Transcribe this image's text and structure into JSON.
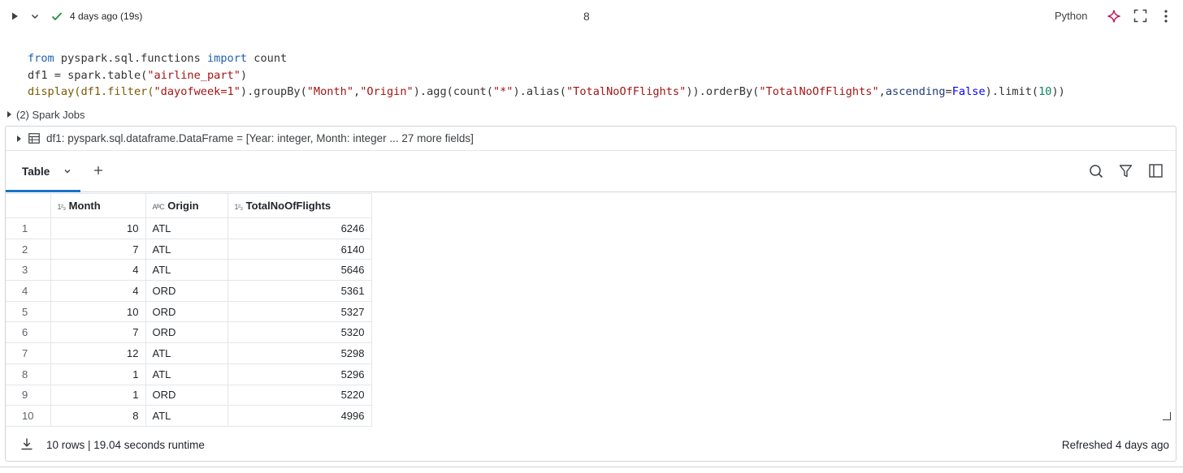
{
  "cell": {
    "status": "4 days ago (19s)",
    "number": "8",
    "language": "Python"
  },
  "code": {
    "line1": [
      "from",
      " pyspark.sql.functions ",
      "import",
      " count"
    ],
    "line2": [
      "df1 = spark.table(",
      "\"airline_part\"",
      ")"
    ],
    "line3": {
      "a": "display(df1.filter(",
      "b": "\"dayofweek=1\"",
      "c": ").groupBy(",
      "d": "\"Month\"",
      "e": ",",
      "f": "\"Origin\"",
      "g": ").agg(count(",
      "h": "\"*\"",
      "i": ").alias(",
      "j": "\"TotalNoOfFlights\"",
      "k": ")).orderBy(",
      "l": "\"TotalNoOfFlights\"",
      "m": ",",
      "n": "ascending",
      "o": "=",
      "p": "False",
      "q": ").limit(",
      "r": "10",
      "s": "))"
    }
  },
  "spark_jobs": "(2) Spark Jobs",
  "dataframe": {
    "summary": "df1:  pyspark.sql.dataframe.DataFrame = [Year: integer, Month: integer ... 27 more fields]"
  },
  "toolbar": {
    "tab_label": "Table"
  },
  "table": {
    "columns": [
      {
        "type_icon": "1²₃",
        "label": "Month"
      },
      {
        "type_icon": "AᴮC",
        "label": "Origin"
      },
      {
        "type_icon": "1²₃",
        "label": "TotalNoOfFlights"
      }
    ],
    "rows": [
      {
        "idx": "1",
        "month": "10",
        "origin": "ATL",
        "total": "6246"
      },
      {
        "idx": "2",
        "month": "7",
        "origin": "ATL",
        "total": "6140"
      },
      {
        "idx": "3",
        "month": "4",
        "origin": "ATL",
        "total": "5646"
      },
      {
        "idx": "4",
        "month": "4",
        "origin": "ORD",
        "total": "5361"
      },
      {
        "idx": "5",
        "month": "10",
        "origin": "ORD",
        "total": "5327"
      },
      {
        "idx": "6",
        "month": "7",
        "origin": "ORD",
        "total": "5320"
      },
      {
        "idx": "7",
        "month": "12",
        "origin": "ATL",
        "total": "5298"
      },
      {
        "idx": "8",
        "month": "1",
        "origin": "ATL",
        "total": "5296"
      },
      {
        "idx": "9",
        "month": "1",
        "origin": "ORD",
        "total": "5220"
      },
      {
        "idx": "10",
        "month": "8",
        "origin": "ATL",
        "total": "4996"
      }
    ]
  },
  "footer": {
    "summary": "10 rows  |  19.04 seconds runtime",
    "refreshed": "Refreshed 4 days ago"
  },
  "colors": {
    "accent": "#1a73c8",
    "success": "#1e8e3e",
    "sparkle": "#c2185b"
  }
}
